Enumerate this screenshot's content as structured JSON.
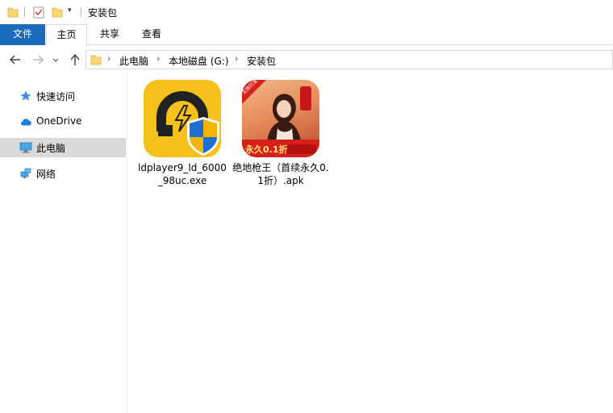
{
  "window": {
    "title": "安装包"
  },
  "ribbon": {
    "tabs": [
      "文件",
      "主页",
      "共享",
      "查看"
    ]
  },
  "breadcrumb": [
    "此电脑",
    "本地磁盘 (G:)",
    "安装包"
  ],
  "sidebar": {
    "items": [
      {
        "label": "快速访问",
        "icon": "star-icon"
      },
      {
        "label": "OneDrive",
        "icon": "cloud-icon"
      },
      {
        "label": "此电脑",
        "icon": "computer-icon",
        "selected": true
      },
      {
        "label": "网络",
        "icon": "network-icon"
      }
    ]
  },
  "files": [
    {
      "name": "ldplayer9_ld_6000_98uc.exe",
      "icon": "ldplayer-app-icon"
    },
    {
      "name": "绝地枪王（首续永久0.1折）.apk",
      "icon": "game-apk-icon",
      "badge": "永久0.1折",
      "corner": "无限打金"
    }
  ],
  "colors": {
    "file_tab": "#1c6bbd",
    "selected_nav": "#d9d9d9",
    "ld_yellow": "#f5c11a"
  }
}
